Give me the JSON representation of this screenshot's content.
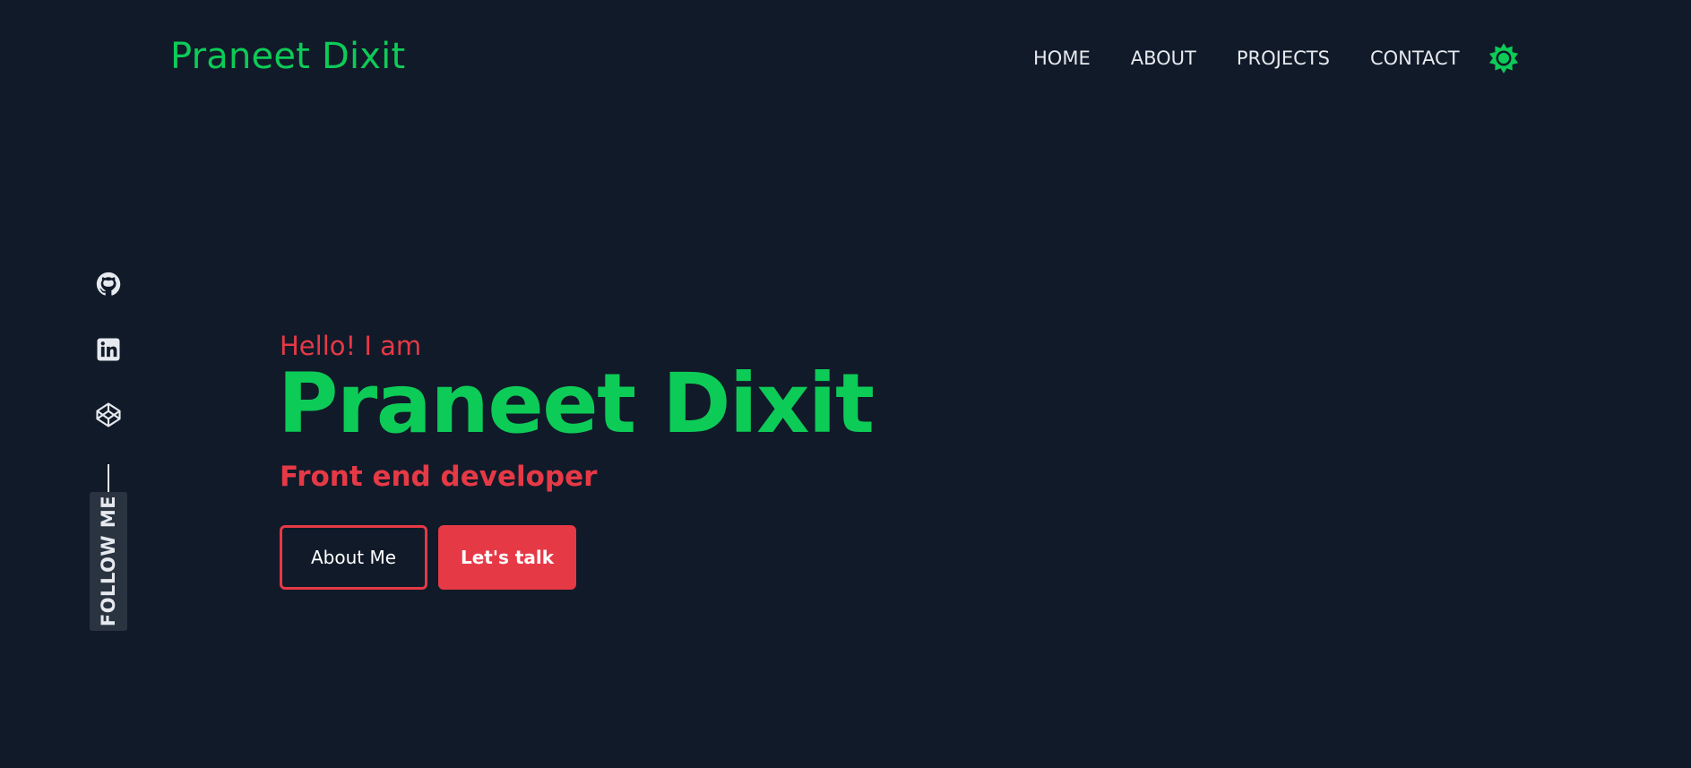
{
  "header": {
    "brand": "Praneet Dixit",
    "nav": [
      "HOME",
      "ABOUT",
      "PROJECTS",
      "CONTACT"
    ],
    "theme_toggle_icon": "sun-icon"
  },
  "social": {
    "icons": [
      "github-icon",
      "linkedin-icon",
      "codepen-icon"
    ],
    "follow_label": "FOLLOW ME"
  },
  "hero": {
    "greeting": "Hello! I am",
    "name": "Praneet Dixit",
    "role": "Front end developer",
    "primary_button": "About Me",
    "secondary_button": "Let's talk"
  },
  "colors": {
    "background": "#111a29",
    "accent_green": "#0dcb57",
    "accent_red": "#e63946",
    "text": "#e6e9ee"
  }
}
